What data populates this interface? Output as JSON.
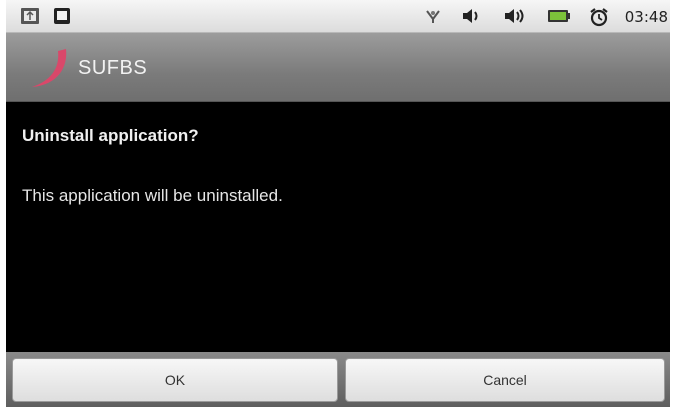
{
  "status_bar": {
    "time": "03:48",
    "icons": [
      "usb-icon",
      "sd-card-icon",
      "signal-icon",
      "volume-icon",
      "volume-icon",
      "battery-icon",
      "alarm-clock-icon"
    ]
  },
  "title_bar": {
    "app_name": "SUFBS",
    "logo_icon": "swoosh-logo-icon",
    "logo_color": "#d9486a"
  },
  "dialog": {
    "title": "Uninstall application?",
    "message": "This application will be uninstalled."
  },
  "buttons": {
    "ok_label": "OK",
    "cancel_label": "Cancel"
  },
  "colors": {
    "dialog_background": "#000000",
    "title_bar": "#7b7b7b",
    "battery_green": "#7cc23a"
  }
}
